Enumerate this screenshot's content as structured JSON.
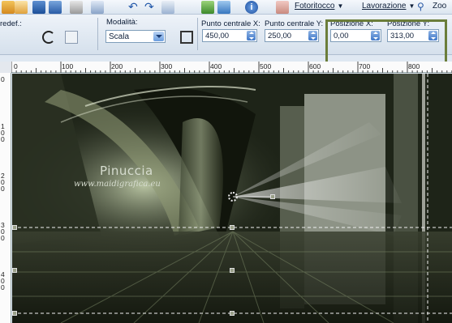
{
  "menus": {
    "fotoritocco": "Fotoritocco",
    "lavorazione": "Lavorazione",
    "zoom": "Zoo"
  },
  "options": {
    "predef_label": "redef.:",
    "modalita_label": "Modalità:",
    "modalita_value": "Scala",
    "centro_x_label": "Punto centrale X:",
    "centro_x_value": "450,00",
    "centro_y_label": "Punto centrale Y:",
    "centro_y_value": "250,00",
    "pos_x_label": "Posizione X:",
    "pos_x_value": "0,00",
    "pos_y_label": "Posizione Y:",
    "pos_y_value": "313,00"
  },
  "ruler_top": [
    "0",
    "100",
    "200",
    "300",
    "400",
    "500",
    "600",
    "700",
    "800"
  ],
  "ruler_left": [
    "0",
    "1\n0\n0",
    "2\n0\n0",
    "3\n0\n0",
    "4\n0\n0"
  ],
  "watermark": {
    "name": "Pinuccia",
    "url": "www.maidigrafica.eu"
  },
  "colors": {
    "highlight_border": "#6b7d3a",
    "canvas_dark": "#1a1f14",
    "accent_green": "#c8d4b0"
  }
}
